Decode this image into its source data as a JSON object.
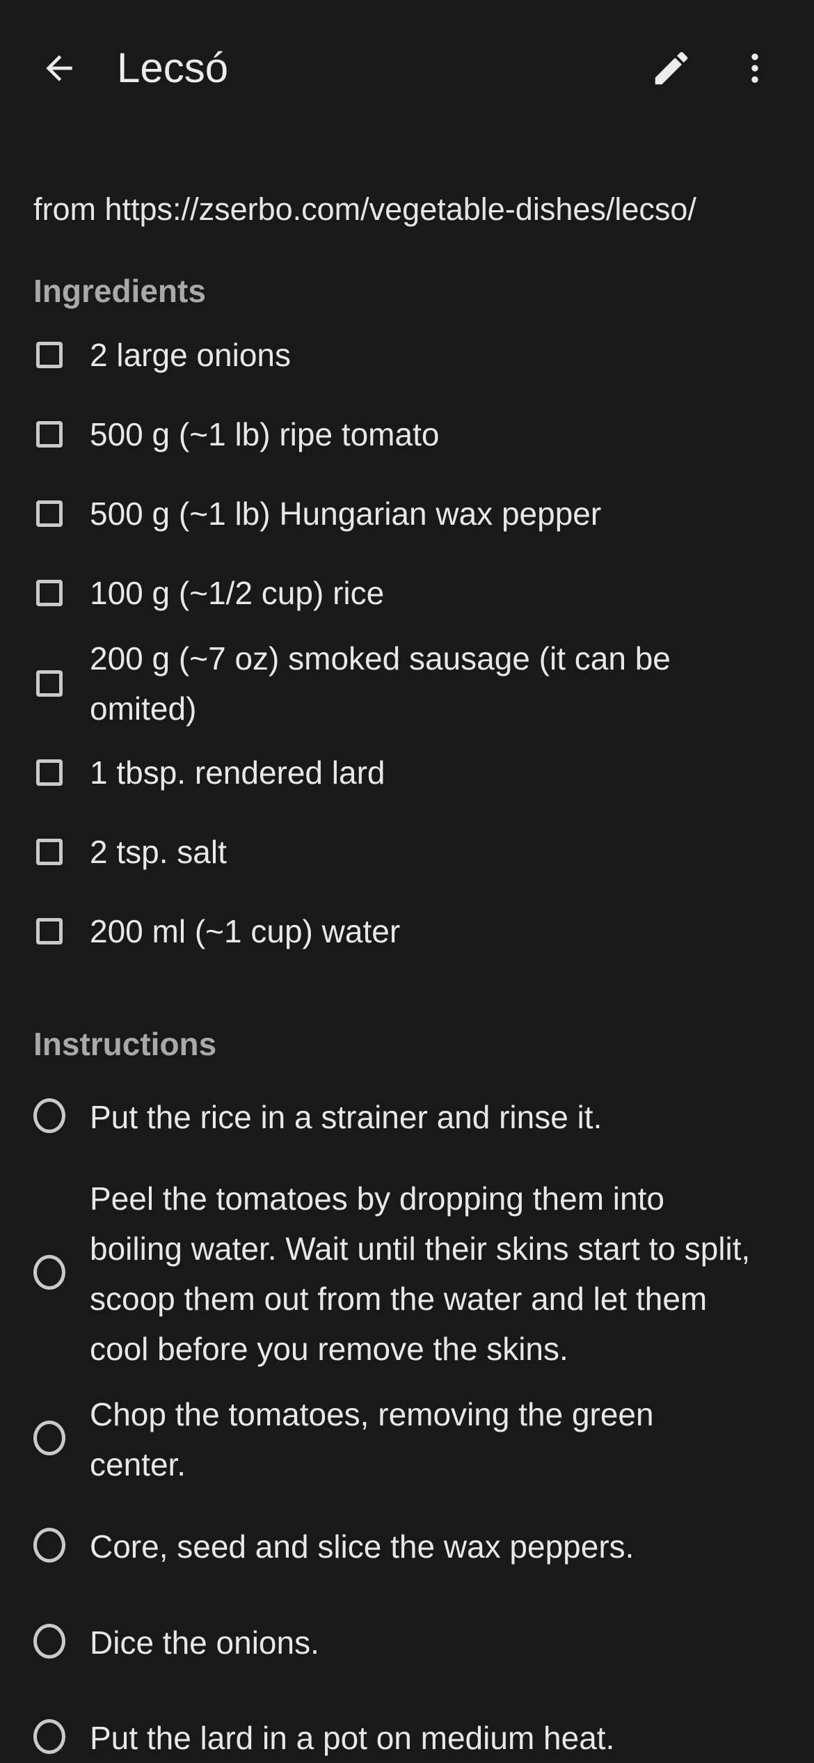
{
  "header": {
    "title": "Lecsó",
    "back_icon": "arrow-left-icon",
    "edit_icon": "pencil-icon",
    "more_icon": "more-vertical-icon"
  },
  "source": "from https://zserbo.com/vegetable-dishes/lecso/",
  "ingredients": {
    "heading": "Ingredients",
    "items": [
      "2 large onions",
      "500 g (~1 lb) ripe tomato",
      "500 g (~1 lb) Hungarian wax pepper",
      "100 g (~1/2 cup) rice",
      "200 g (~7 oz) smoked sausage (it can be omited)",
      "1 tbsp. rendered lard",
      "2 tsp. salt",
      "200 ml (~1 cup) water"
    ]
  },
  "instructions": {
    "heading": "Instructions",
    "steps": [
      "Put the rice in a strainer and rinse it.",
      "Peel the tomatoes by dropping them into boiling water. Wait until their skins start to split, scoop them out from the water and let them cool before you remove the skins.",
      "Chop the tomatoes, removing the green center.",
      "Core, seed and slice the wax peppers.",
      "Dice the onions.",
      "Put the lard in a pot on medium heat."
    ]
  }
}
